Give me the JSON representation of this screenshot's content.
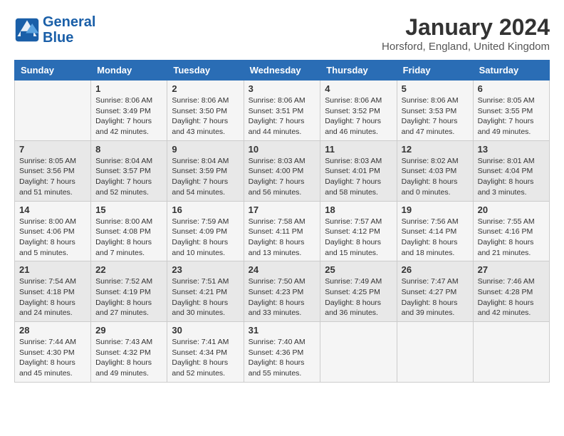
{
  "header": {
    "logo_line1": "General",
    "logo_line2": "Blue",
    "title": "January 2024",
    "subtitle": "Horsford, England, United Kingdom"
  },
  "days_of_week": [
    "Sunday",
    "Monday",
    "Tuesday",
    "Wednesday",
    "Thursday",
    "Friday",
    "Saturday"
  ],
  "weeks": [
    [
      {
        "day": "",
        "info": ""
      },
      {
        "day": "1",
        "info": "Sunrise: 8:06 AM\nSunset: 3:49 PM\nDaylight: 7 hours\nand 42 minutes."
      },
      {
        "day": "2",
        "info": "Sunrise: 8:06 AM\nSunset: 3:50 PM\nDaylight: 7 hours\nand 43 minutes."
      },
      {
        "day": "3",
        "info": "Sunrise: 8:06 AM\nSunset: 3:51 PM\nDaylight: 7 hours\nand 44 minutes."
      },
      {
        "day": "4",
        "info": "Sunrise: 8:06 AM\nSunset: 3:52 PM\nDaylight: 7 hours\nand 46 minutes."
      },
      {
        "day": "5",
        "info": "Sunrise: 8:06 AM\nSunset: 3:53 PM\nDaylight: 7 hours\nand 47 minutes."
      },
      {
        "day": "6",
        "info": "Sunrise: 8:05 AM\nSunset: 3:55 PM\nDaylight: 7 hours\nand 49 minutes."
      }
    ],
    [
      {
        "day": "7",
        "info": "Sunrise: 8:05 AM\nSunset: 3:56 PM\nDaylight: 7 hours\nand 51 minutes."
      },
      {
        "day": "8",
        "info": "Sunrise: 8:04 AM\nSunset: 3:57 PM\nDaylight: 7 hours\nand 52 minutes."
      },
      {
        "day": "9",
        "info": "Sunrise: 8:04 AM\nSunset: 3:59 PM\nDaylight: 7 hours\nand 54 minutes."
      },
      {
        "day": "10",
        "info": "Sunrise: 8:03 AM\nSunset: 4:00 PM\nDaylight: 7 hours\nand 56 minutes."
      },
      {
        "day": "11",
        "info": "Sunrise: 8:03 AM\nSunset: 4:01 PM\nDaylight: 7 hours\nand 58 minutes."
      },
      {
        "day": "12",
        "info": "Sunrise: 8:02 AM\nSunset: 4:03 PM\nDaylight: 8 hours\nand 0 minutes."
      },
      {
        "day": "13",
        "info": "Sunrise: 8:01 AM\nSunset: 4:04 PM\nDaylight: 8 hours\nand 3 minutes."
      }
    ],
    [
      {
        "day": "14",
        "info": "Sunrise: 8:00 AM\nSunset: 4:06 PM\nDaylight: 8 hours\nand 5 minutes."
      },
      {
        "day": "15",
        "info": "Sunrise: 8:00 AM\nSunset: 4:08 PM\nDaylight: 8 hours\nand 7 minutes."
      },
      {
        "day": "16",
        "info": "Sunrise: 7:59 AM\nSunset: 4:09 PM\nDaylight: 8 hours\nand 10 minutes."
      },
      {
        "day": "17",
        "info": "Sunrise: 7:58 AM\nSunset: 4:11 PM\nDaylight: 8 hours\nand 13 minutes."
      },
      {
        "day": "18",
        "info": "Sunrise: 7:57 AM\nSunset: 4:12 PM\nDaylight: 8 hours\nand 15 minutes."
      },
      {
        "day": "19",
        "info": "Sunrise: 7:56 AM\nSunset: 4:14 PM\nDaylight: 8 hours\nand 18 minutes."
      },
      {
        "day": "20",
        "info": "Sunrise: 7:55 AM\nSunset: 4:16 PM\nDaylight: 8 hours\nand 21 minutes."
      }
    ],
    [
      {
        "day": "21",
        "info": "Sunrise: 7:54 AM\nSunset: 4:18 PM\nDaylight: 8 hours\nand 24 minutes."
      },
      {
        "day": "22",
        "info": "Sunrise: 7:52 AM\nSunset: 4:19 PM\nDaylight: 8 hours\nand 27 minutes."
      },
      {
        "day": "23",
        "info": "Sunrise: 7:51 AM\nSunset: 4:21 PM\nDaylight: 8 hours\nand 30 minutes."
      },
      {
        "day": "24",
        "info": "Sunrise: 7:50 AM\nSunset: 4:23 PM\nDaylight: 8 hours\nand 33 minutes."
      },
      {
        "day": "25",
        "info": "Sunrise: 7:49 AM\nSunset: 4:25 PM\nDaylight: 8 hours\nand 36 minutes."
      },
      {
        "day": "26",
        "info": "Sunrise: 7:47 AM\nSunset: 4:27 PM\nDaylight: 8 hours\nand 39 minutes."
      },
      {
        "day": "27",
        "info": "Sunrise: 7:46 AM\nSunset: 4:28 PM\nDaylight: 8 hours\nand 42 minutes."
      }
    ],
    [
      {
        "day": "28",
        "info": "Sunrise: 7:44 AM\nSunset: 4:30 PM\nDaylight: 8 hours\nand 45 minutes."
      },
      {
        "day": "29",
        "info": "Sunrise: 7:43 AM\nSunset: 4:32 PM\nDaylight: 8 hours\nand 49 minutes."
      },
      {
        "day": "30",
        "info": "Sunrise: 7:41 AM\nSunset: 4:34 PM\nDaylight: 8 hours\nand 52 minutes."
      },
      {
        "day": "31",
        "info": "Sunrise: 7:40 AM\nSunset: 4:36 PM\nDaylight: 8 hours\nand 55 minutes."
      },
      {
        "day": "",
        "info": ""
      },
      {
        "day": "",
        "info": ""
      },
      {
        "day": "",
        "info": ""
      }
    ]
  ]
}
